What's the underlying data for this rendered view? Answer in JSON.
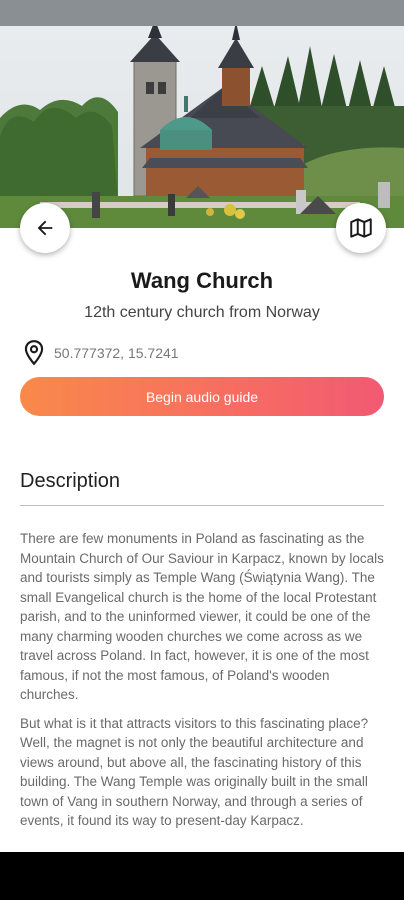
{
  "header": {
    "back_icon": "arrow-left-icon",
    "map_icon": "map-icon"
  },
  "place": {
    "title": "Wang Church",
    "subtitle": "12th century church from Norway",
    "coordinates": "50.777372, 15.7241",
    "coordinates_icon": "location-pin-icon"
  },
  "actions": {
    "audio_guide_label": "Begin audio guide"
  },
  "description": {
    "heading": "Description",
    "paragraphs": [
      "There are few monuments in Poland as fascinating as the Mountain Church of Our Saviour in Karpacz, known by locals and tourists simply as Temple Wang (Świątynia Wang). The small Evangelical church is the home of the local Protestant parish, and to the uninformed viewer, it could be one of the many charming wooden churches we come across as we travel across Poland. In fact, however, it is one of the most famous, if not the most famous, of Poland's wooden churches.",
      "But what is it that attracts visitors to this fascinating place? Well, the magnet is not only the beautiful architecture and views around, but above all, the fascinating history of this building. The Wang Temple was originally built in the small town of Vang in southern Norway, and through a series of events, it found its way to present-day Karpacz."
    ]
  },
  "colors": {
    "gradient_start": "#f9894a",
    "gradient_end": "#f15a73"
  }
}
